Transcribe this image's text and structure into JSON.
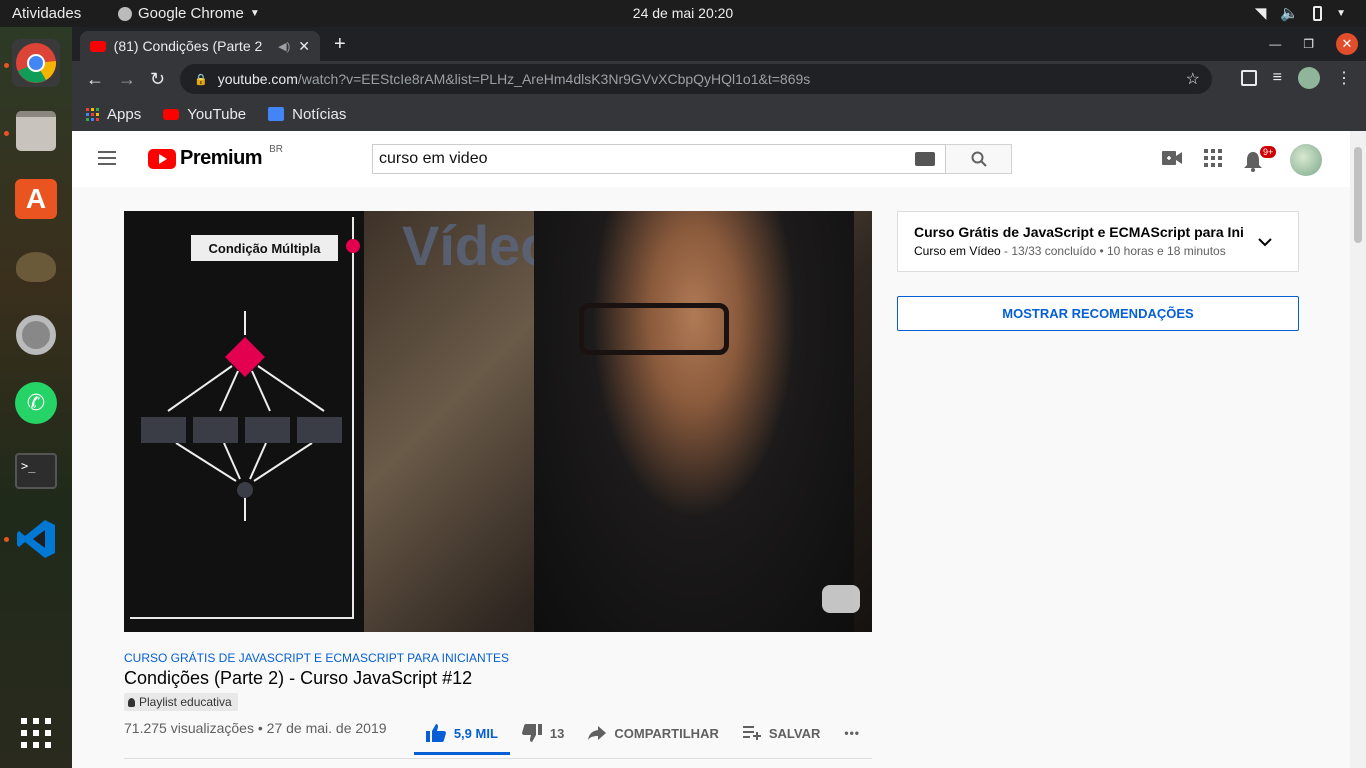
{
  "system": {
    "activities": "Atividades",
    "app_name": "Google Chrome",
    "clock": "24 de mai  20:20"
  },
  "dock": {
    "items": [
      "chrome-icon",
      "files-icon",
      "software-center-icon",
      "gimp-icon",
      "settings-icon",
      "whatsapp-icon",
      "terminal-icon",
      "vscode-icon",
      "app-grid-icon"
    ]
  },
  "browser": {
    "tab_title": "(81) Condições (Parte 2",
    "new_tab": "+",
    "url_host": "youtube.com",
    "url_rest": "/watch?v=EEStcIe8rAM&list=PLHz_AreHm4dlsK3Nr9GVvXCbpQyHQl1o1&t=869s",
    "bookmarks": [
      "Apps",
      "YouTube",
      "Notícias"
    ]
  },
  "youtube": {
    "logo_text": "Premium",
    "region": "BR",
    "search_value": "curso em video",
    "notifications": "9+"
  },
  "video": {
    "diagram_title": "Condição Múltipla",
    "overlay_word": "Vídeo",
    "playlist_link": "CURSO GRÁTIS DE JAVASCRIPT E ECMASCRIPT PARA INICIANTES",
    "title": "Condições (Parte 2) - Curso JavaScript #12",
    "chip": "Playlist educativa",
    "stats": "71.275 visualizações • 27 de mai. de 2019",
    "likes": "5,9 MIL",
    "dislikes": "13",
    "share": "COMPARTILHAR",
    "save": "SALVAR",
    "more": "•••"
  },
  "sidebar": {
    "playlist_title": "Curso Grátis de JavaScript e ECMAScript para Inician",
    "playlist_channel": "Curso em Vídeo",
    "playlist_meta": " - 13/33 concluído • 10 horas e 18 minutos",
    "show_recommendations": "MOSTRAR RECOMENDAÇÕES"
  },
  "colors": {
    "accent": "#065fd4",
    "youtube_red": "#ff0000",
    "diagram_pink": "#e2004f"
  }
}
